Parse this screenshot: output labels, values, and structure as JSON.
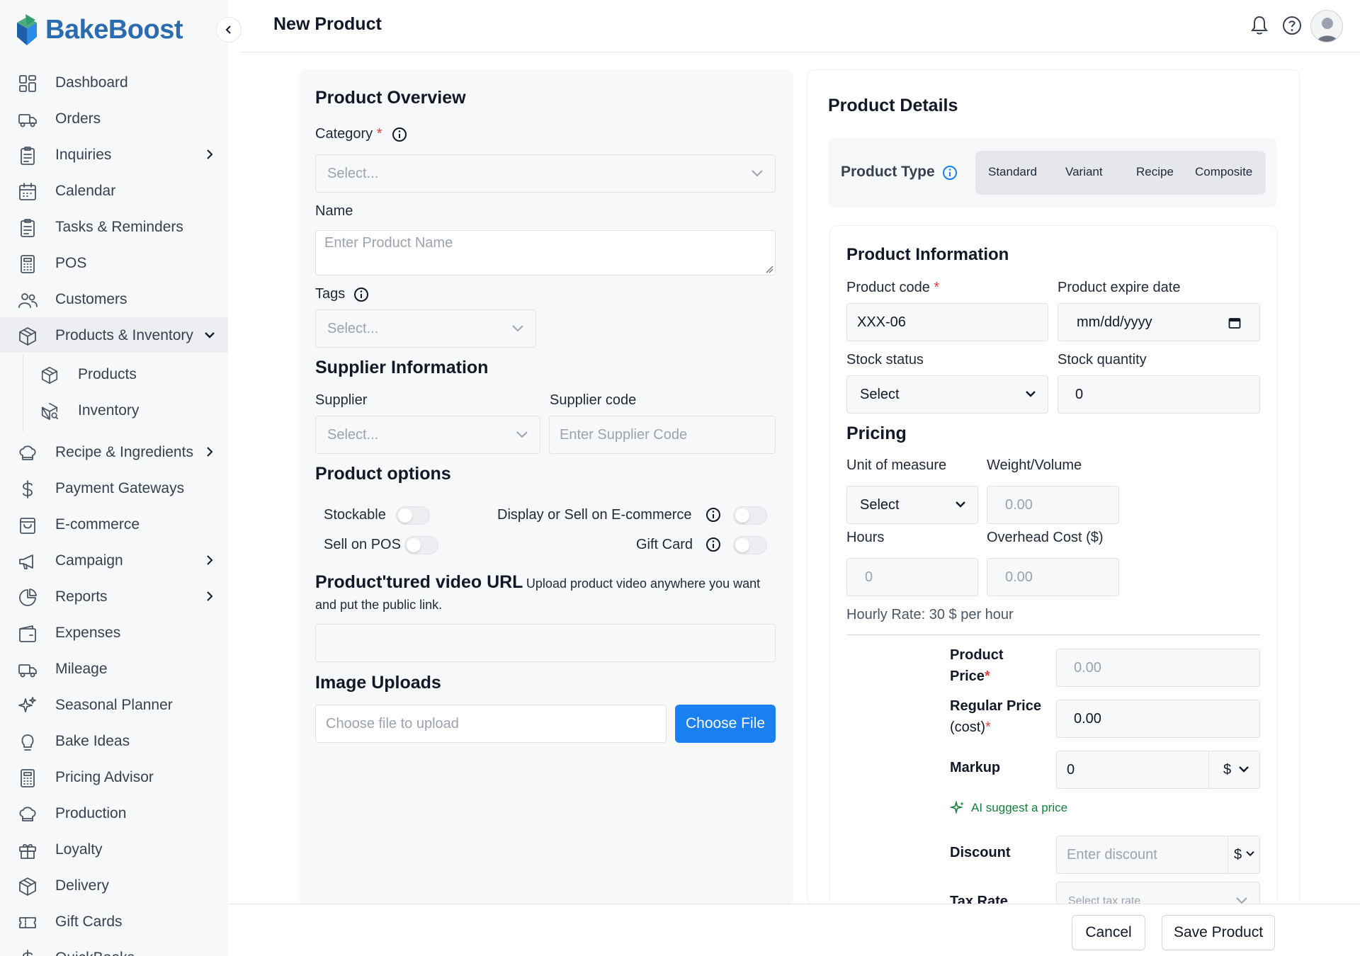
{
  "app": {
    "name": "BakeBoost"
  },
  "header": {
    "title": "New Product"
  },
  "sidebar": {
    "items": [
      {
        "label": "Dashboard",
        "icon": "dashboard-icon"
      },
      {
        "label": "Orders",
        "icon": "truck-icon"
      },
      {
        "label": "Inquiries",
        "icon": "clipboard-icon"
      },
      {
        "label": "Calendar",
        "icon": "calendar-icon"
      },
      {
        "label": "Tasks & Reminders",
        "icon": "clipboard-icon"
      },
      {
        "label": "POS",
        "icon": "calculator-icon"
      },
      {
        "label": "Customers",
        "icon": "users-icon"
      },
      {
        "label": "Products & Inventory",
        "icon": "box-icon"
      },
      {
        "label": "Products",
        "icon": "box-icon"
      },
      {
        "label": "Inventory",
        "icon": "box-search-icon"
      },
      {
        "label": "Recipe & Ingredients",
        "icon": "chef-hat-icon"
      },
      {
        "label": "Payment Gateways",
        "icon": "dollar-icon"
      },
      {
        "label": "E-commerce",
        "icon": "shopping-bag-icon"
      },
      {
        "label": "Campaign",
        "icon": "megaphone-icon"
      },
      {
        "label": "Reports",
        "icon": "pie-chart-icon"
      },
      {
        "label": "Expenses",
        "icon": "wallet-icon"
      },
      {
        "label": "Mileage",
        "icon": "truck-icon"
      },
      {
        "label": "Seasonal Planner",
        "icon": "sparkles-icon"
      },
      {
        "label": "Bake Ideas",
        "icon": "lightbulb-icon"
      },
      {
        "label": "Pricing Advisor",
        "icon": "calculator-icon"
      },
      {
        "label": "Production",
        "icon": "chef-hat-icon"
      },
      {
        "label": "Loyalty",
        "icon": "gift-icon"
      },
      {
        "label": "Delivery",
        "icon": "box-icon"
      },
      {
        "label": "Gift Cards",
        "icon": "ticket-icon"
      },
      {
        "label": "QuickBooks",
        "icon": "dollar-icon"
      }
    ]
  },
  "overview": {
    "title": "Product Overview",
    "category_label": "Category",
    "category_placeholder": "Select...",
    "name_label": "Name",
    "name_placeholder": "Enter Product Name",
    "tags_label": "Tags",
    "tags_placeholder": "Select...",
    "supplier_title": "Supplier Information",
    "supplier_label": "Supplier",
    "supplier_placeholder": "Select...",
    "supplier_code_label": "Supplier code",
    "supplier_code_placeholder": "Enter Supplier Code",
    "options_title": "Product options",
    "stockable_label": "Stockable",
    "display_label": "Display or Sell on E-commerce",
    "sell_pos_label": "Sell on POS",
    "gift_card_label": "Gift Card",
    "video_title": "Product'tured video URL",
    "video_hint_1": "Upload product video anywhere you want",
    "video_hint_2": "and put the public link.",
    "uploads_title": "Image Uploads",
    "upload_placeholder": "Choose file to upload",
    "choose_file_label": "Choose File"
  },
  "details": {
    "title": "Product Details",
    "product_type_label": "Product Type",
    "product_types": [
      "Standard",
      "Variant",
      "Recipe",
      "Composite"
    ],
    "info_title": "Product Information",
    "code_label": "Product code",
    "code_value": "XXX-06",
    "expire_label": "Product expire date",
    "expire_value": "mm/dd/yyyy",
    "stock_status_label": "Stock status",
    "stock_status_value": "Select",
    "stock_qty_label": "Stock quantity",
    "stock_qty_value": "0",
    "pricing_title": "Pricing",
    "uom_label": "Unit of measure",
    "uom_value": "Select",
    "weight_label": "Weight/Volume",
    "weight_placeholder": "0.00",
    "hours_label": "Hours",
    "hours_placeholder": "0",
    "overhead_label": "Overhead Cost ($)",
    "overhead_placeholder": "0.00",
    "hourly_rate_text": "Hourly Rate: 30 $ per hour",
    "product_price_label_1": "Product",
    "product_price_label_2": "Price",
    "product_price_placeholder": "0.00",
    "regular_price_label_1": "Regular Price",
    "regular_price_label_2": "(cost)",
    "regular_price_value": "0.00",
    "markup_label": "Markup",
    "markup_value": "0",
    "markup_unit": "$",
    "ai_suggest_label": "AI suggest a price",
    "discount_label": "Discount",
    "discount_placeholder": "Enter discount",
    "discount_unit": "$",
    "tax_label": "Tax Rate",
    "tax_placeholder": "Select tax rate"
  },
  "footer": {
    "cancel_label": "Cancel",
    "save_label": "Save Product"
  },
  "colors": {
    "brand": "#2b6cb0",
    "primary": "#1a7ff0",
    "required": "#e53e3e",
    "ai": "#15803d"
  }
}
